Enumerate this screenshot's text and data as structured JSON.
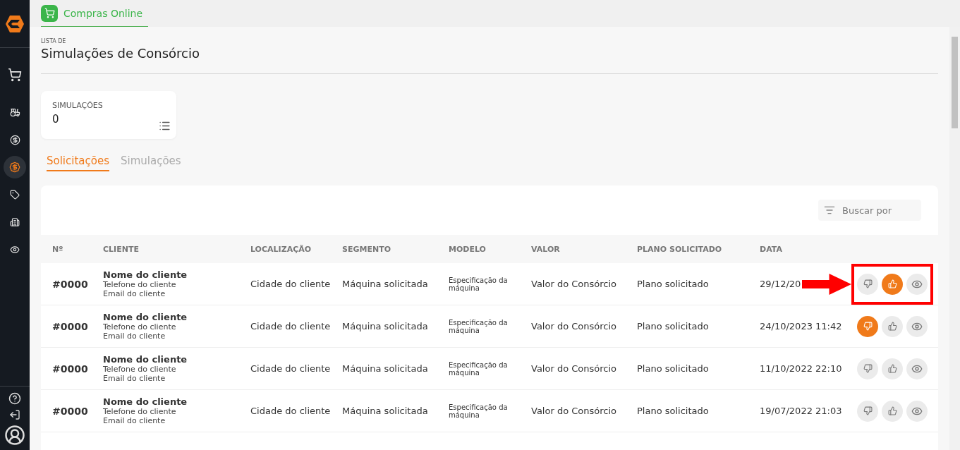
{
  "sidebar": {
    "items": [
      {
        "kind": "cart",
        "selected": false
      },
      {
        "kind": "tractor",
        "selected": false
      },
      {
        "kind": "dollar",
        "selected": false
      },
      {
        "kind": "exchange",
        "selected": true
      },
      {
        "kind": "tag",
        "selected": false
      },
      {
        "kind": "building",
        "selected": false
      },
      {
        "kind": "eye",
        "selected": false
      }
    ],
    "bottom": [
      {
        "kind": "help"
      },
      {
        "kind": "logout"
      },
      {
        "kind": "avatar"
      }
    ]
  },
  "top_tabs": [
    {
      "label": "Compras Online",
      "selected": true
    }
  ],
  "header": {
    "overline": "LISTA DE",
    "title": "Simulações de Consórcio"
  },
  "stat_card": {
    "label": "SIMULAÇÕES",
    "value": "0"
  },
  "tabs": [
    {
      "label": "Solicitações",
      "selected": true
    },
    {
      "label": "Simulações",
      "selected": false
    }
  ],
  "search": {
    "placeholder": "Buscar por"
  },
  "table": {
    "columns": [
      "Nº",
      "CLIENTE",
      "LOCALIZAÇÃO",
      "SEGMENTO",
      "MODELO",
      "VALOR",
      "PLANO SOLICITADO",
      "DATA"
    ],
    "rows": [
      {
        "number": "#0000",
        "client_name": "Nome do cliente",
        "client_phone": "Telefone do cliente",
        "client_email": "Email do cliente",
        "location": "Cidade do cliente",
        "segment": "Máquina solicitada",
        "model": "Especificação da máquina",
        "value": "Valor do Consórcio",
        "plan": "Plano solicitado",
        "date": "29/12/20",
        "rejected": false,
        "approved": true,
        "highlighted": true
      },
      {
        "number": "#0000",
        "client_name": "Nome do cliente",
        "client_phone": "Telefone do cliente",
        "client_email": "Email do cliente",
        "location": "Cidade do cliente",
        "segment": "Máquina solicitada",
        "model": "Especificação da máquina",
        "value": "Valor do Consórcio",
        "plan": "Plano solicitado",
        "date": "24/10/2023 11:42",
        "rejected": true,
        "approved": false,
        "highlighted": false
      },
      {
        "number": "#0000",
        "client_name": "Nome do cliente",
        "client_phone": "Telefone do cliente",
        "client_email": "Email do cliente",
        "location": "Cidade do cliente",
        "segment": "Máquina solicitada",
        "model": "Especificação da máquina",
        "value": "Valor do Consórcio",
        "plan": "Plano solicitado",
        "date": "11/10/2022 22:10",
        "rejected": false,
        "approved": false,
        "highlighted": false
      },
      {
        "number": "#0000",
        "client_name": "Nome do cliente",
        "client_phone": "Telefone do cliente",
        "client_email": "Email do cliente",
        "location": "Cidade do cliente",
        "segment": "Máquina solicitada",
        "model": "Especificação da máquina",
        "value": "Valor do Consórcio",
        "plan": "Plano solicitado",
        "date": "19/07/2022 21:03",
        "rejected": false,
        "approved": false,
        "highlighted": false
      }
    ]
  }
}
